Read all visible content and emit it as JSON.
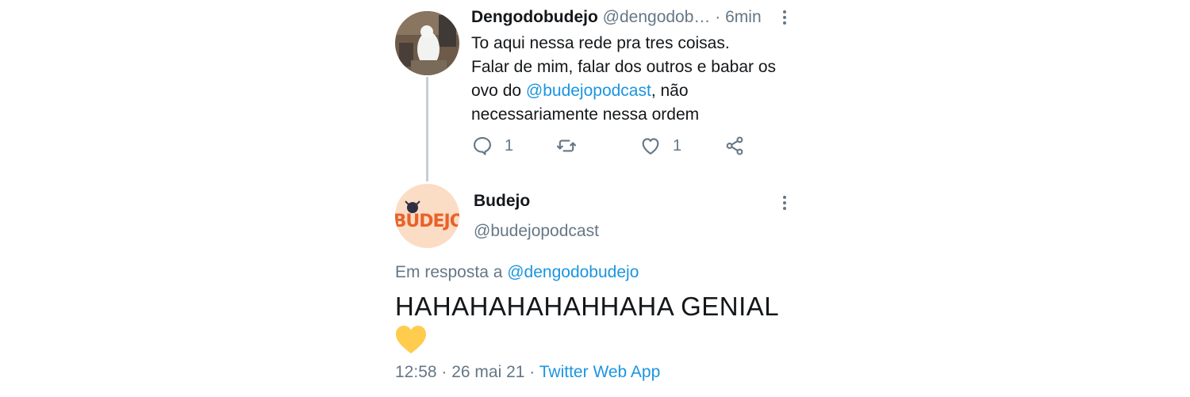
{
  "tweet1": {
    "name": "Dengodobudejo",
    "handle": "@dengodob…",
    "separator": "·",
    "time": "6min",
    "text_line1": "To aqui nessa rede pra tres coisas.",
    "text_line2": "Falar de mim, falar dos outros e babar os",
    "text_line3_pre": "ovo do ",
    "text_mention": "@budejopodcast",
    "text_line3_post": ", não",
    "text_line4": "necessariamente nessa ordem",
    "replies": "1",
    "likes": "1",
    "icons": [
      "more-vertical-icon",
      "reply-icon",
      "retweet-icon",
      "like-icon",
      "share-icon"
    ]
  },
  "tweet2": {
    "name": "Budejo",
    "handle": "@budejopodcast",
    "avatar_text": "BUDEJO",
    "reply_prefix": "Em resposta a ",
    "reply_to": "@dengodobudejo",
    "text": "HAHAHAHAHAHHAHA GENIAL",
    "emoji": "yellow-heart",
    "time": "12:58",
    "date": "26 mai 21",
    "source": "Twitter Web App",
    "meta_sep": " · "
  },
  "colors": {
    "link": "#1b95e0",
    "muted": "#657786",
    "thread_line": "#c4cfd6",
    "avatar_bg": "#fbdcc4",
    "logo": "#e8622a",
    "heart": "#ffcc4d"
  }
}
